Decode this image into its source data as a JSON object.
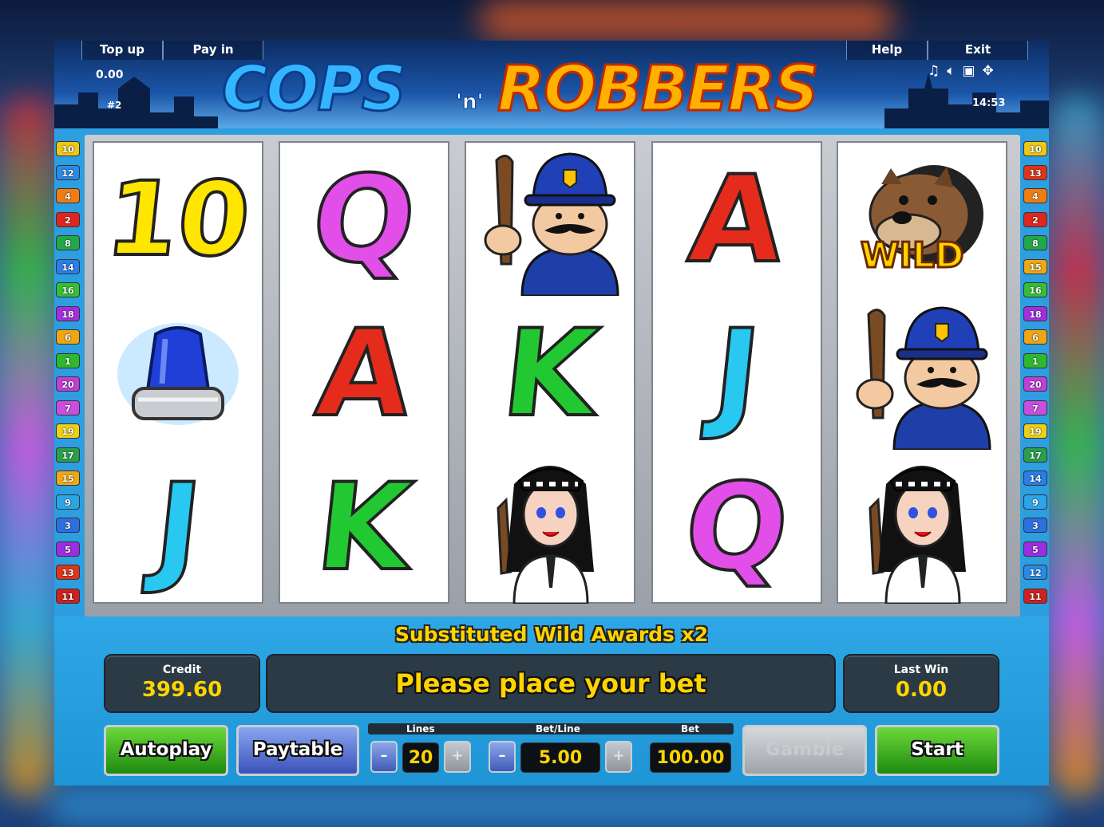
{
  "header": {
    "top_up": "Top up",
    "pay_in": "Pay in",
    "help": "Help",
    "exit": "Exit",
    "balance": "0.00",
    "game_id": "#2",
    "clock": "14:53",
    "logo_left": "COPS",
    "logo_mid": "'n'",
    "logo_right": "ROBBERS",
    "icons": [
      "music-note-icon",
      "speaker-icon",
      "fullscreen-icon",
      "settings-icon"
    ]
  },
  "reels": [
    [
      {
        "type": "letter",
        "text": "10",
        "color": "#ffe600"
      },
      {
        "type": "siren"
      },
      {
        "type": "letter",
        "text": "J",
        "color": "#28c8f0"
      }
    ],
    [
      {
        "type": "letter",
        "text": "Q",
        "color": "#e24ee8"
      },
      {
        "type": "letter",
        "text": "A",
        "color": "#e52b1c"
      },
      {
        "type": "letter",
        "text": "K",
        "color": "#22c832"
      }
    ],
    [
      {
        "type": "policeman"
      },
      {
        "type": "letter",
        "text": "K",
        "color": "#22c832"
      },
      {
        "type": "policewoman"
      }
    ],
    [
      {
        "type": "letter",
        "text": "A",
        "color": "#e52b1c"
      },
      {
        "type": "letter",
        "text": "J",
        "color": "#28c8f0"
      },
      {
        "type": "letter",
        "text": "Q",
        "color": "#e24ee8"
      }
    ],
    [
      {
        "type": "wild",
        "text": "WILD"
      },
      {
        "type": "policeman"
      },
      {
        "type": "policewoman"
      }
    ]
  ],
  "line_markers_left": [
    "10",
    "12",
    "4",
    "2",
    "8",
    "14",
    "16",
    "18",
    "6",
    "1",
    "20",
    "7",
    "19",
    "17",
    "15",
    "9",
    "3",
    "5",
    "13",
    "11"
  ],
  "line_markers_right": [
    "10",
    "13",
    "4",
    "2",
    "8",
    "15",
    "16",
    "18",
    "6",
    "1",
    "20",
    "7",
    "19",
    "17",
    "14",
    "9",
    "3",
    "5",
    "12",
    "11"
  ],
  "marker_colors": {
    "1": "#2db82d",
    "2": "#e0261c",
    "3": "#2d6fe0",
    "4": "#f07d12",
    "5": "#9b2ee0",
    "6": "#f0a514",
    "7": "#c94ee0",
    "8": "#22a84a",
    "9": "#2aa6e8",
    "10": "#f0c814",
    "11": "#d02020",
    "12": "#2a8ae8",
    "13": "#e0341c",
    "14": "#2a7ee8",
    "15": "#f0a814",
    "16": "#34c034",
    "17": "#28a04c",
    "18": "#a22ee0",
    "19": "#f0d014",
    "20": "#c23ed8"
  },
  "message": "Substituted Wild Awards x2",
  "credit": {
    "label": "Credit",
    "value": "399.60"
  },
  "status": "Please place your bet",
  "last_win": {
    "label": "Last Win",
    "value": "0.00"
  },
  "buttons": {
    "autoplay": "Autoplay",
    "paytable": "Paytable",
    "gamble": "Gamble",
    "start": "Start"
  },
  "controls": {
    "lines_label": "Lines",
    "lines_value": "20",
    "betline_label": "Bet/Line",
    "betline_value": "5.00",
    "bet_label": "Bet",
    "bet_value": "100.00",
    "minus": "–",
    "plus": "+"
  },
  "colors": {
    "accent_yellow": "#ffd400",
    "panel_bg": "#2b3a45",
    "game_bg": "#2ea8e6"
  }
}
